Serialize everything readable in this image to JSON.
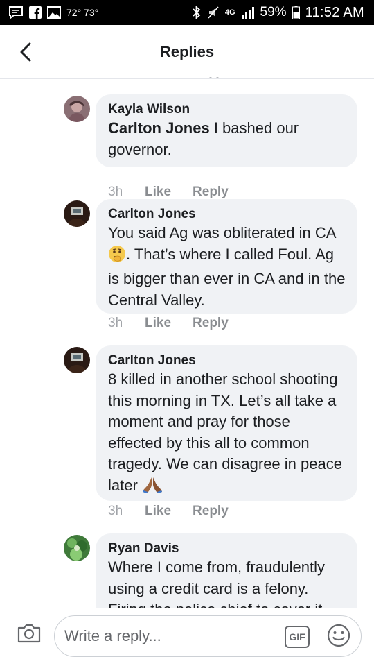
{
  "status_bar": {
    "temperature": "72° 73°",
    "network": "4G",
    "battery": "59%",
    "time": "11:52 AM"
  },
  "header": {
    "title": "Replies"
  },
  "comments": [
    {
      "author": "Kayla Wilson",
      "mention": "Carlton Jones",
      "text": " I bashed our governor.",
      "time": "3h",
      "like_label": "Like",
      "reply_label": "Reply"
    },
    {
      "author": "Carlton Jones",
      "text_before_emoji": "You said Ag was obliterated in CA",
      "text_after_emoji": ". That’s where I called Foul. Ag is bigger than ever in CA and in the Central Valley.",
      "emoji": "thinking-face-icon",
      "time": "3h",
      "like_label": "Like",
      "reply_label": "Reply"
    },
    {
      "author": "Carlton Jones",
      "text": "8 killed in another school shooting this morning in TX. Let’s all take a moment and pray for those effected by this all to common tragedy. We can disagree in peace later ",
      "emoji": "praying-hands-icon",
      "time": "3h",
      "like_label": "Like",
      "reply_label": "Reply"
    },
    {
      "author": "Ryan Davis",
      "text": "Where I come from, fraudulently using a credit card is a felony. Firing the police chief to cover it"
    }
  ],
  "composer": {
    "placeholder": "Write a reply...",
    "gif_label": "GIF"
  }
}
